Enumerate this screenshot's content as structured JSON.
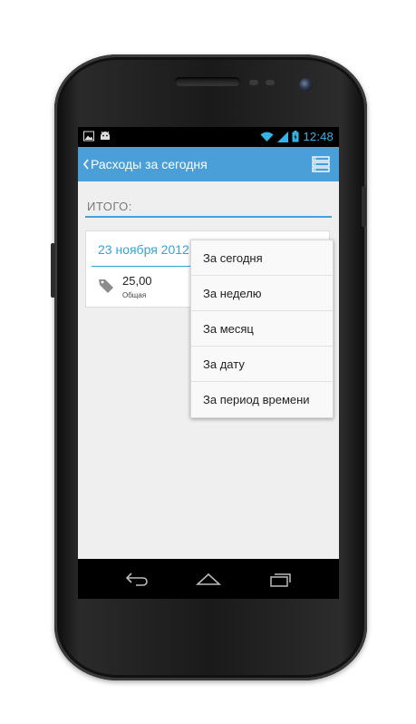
{
  "status_bar": {
    "time": "12:48",
    "left_icons": [
      "image-icon",
      "android-icon"
    ],
    "right_icons": [
      "wifi-icon",
      "signal-icon",
      "battery-icon"
    ],
    "clock_color": "#33b5e5"
  },
  "action_bar": {
    "title": "Расходы за сегодня",
    "color": "#4a9fd9"
  },
  "summary": {
    "label": "ИТОГО:"
  },
  "entry": {
    "date": "23 ноября 2012",
    "amount": "25,00",
    "category": "Общая"
  },
  "menu": {
    "items": [
      {
        "label": "За сегодня"
      },
      {
        "label": "За неделю"
      },
      {
        "label": "За месяц"
      },
      {
        "label": "За дату"
      },
      {
        "label": "За период времени"
      }
    ]
  },
  "navigation": {
    "buttons": [
      "back-icon",
      "home-icon",
      "recent-apps-icon"
    ]
  }
}
